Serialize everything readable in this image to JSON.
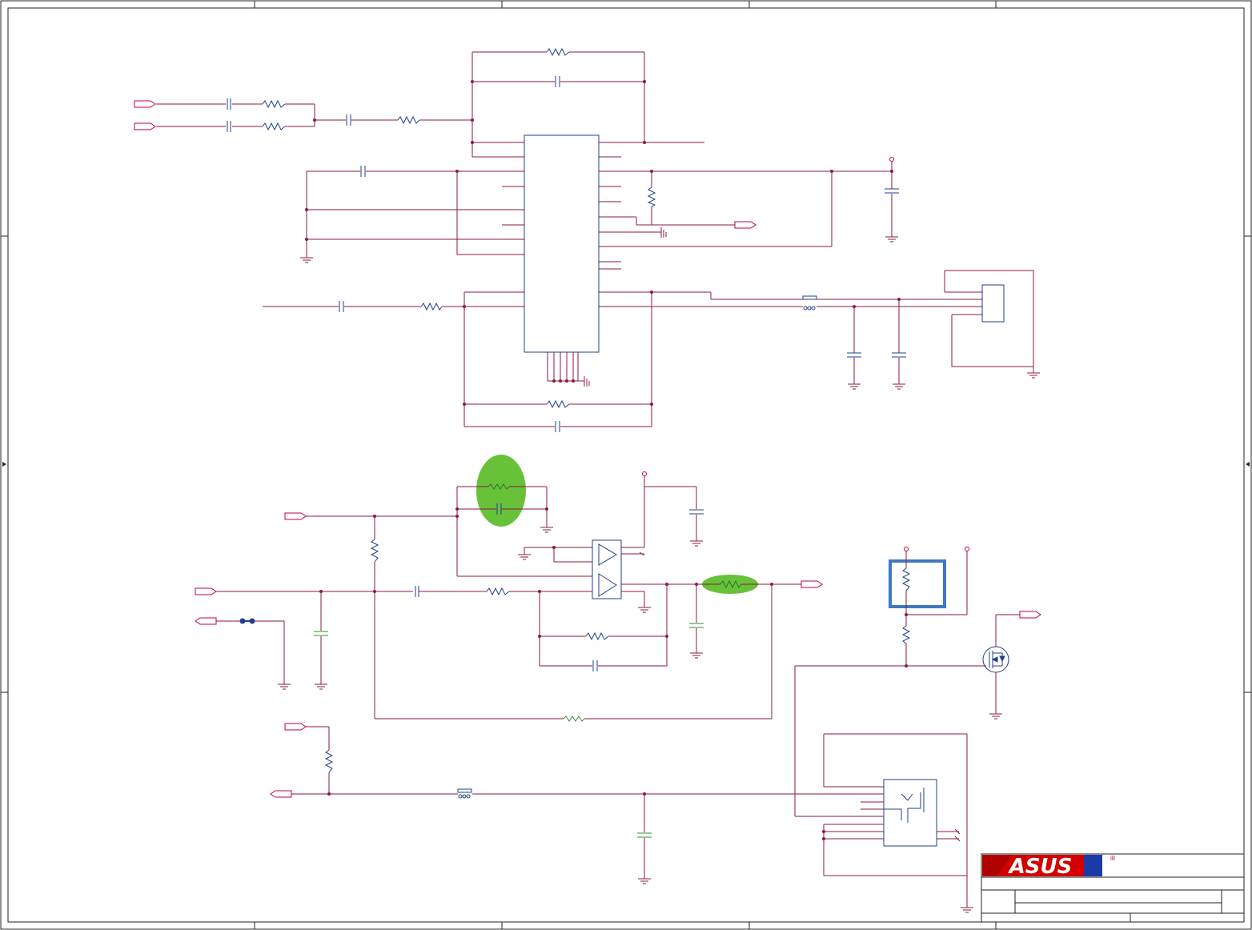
{
  "title_block": {
    "logo_text": "ASUS",
    "logo_mark": "®",
    "colors": {
      "logo_bg": "#d40000",
      "logo_band": "#1b3aa8",
      "logo_text": "#ffffff"
    }
  },
  "colors": {
    "wire": "#8b1a3f",
    "component": "#1f3f8f",
    "frame": "#222222",
    "highlight_fill": "#5fbf2f",
    "highlight_box": "#3f78c2",
    "port": "#c4003a"
  },
  "icons": {
    "ground": "ground-icon",
    "port": "offpage-connector-icon",
    "resistor": "resistor-icon",
    "capacitor": "capacitor-icon",
    "opamp": "opamp-icon",
    "mosfet": "mosfet-icon",
    "ferrite": "ferrite-bead-icon",
    "jack": "audio-jack-icon"
  }
}
